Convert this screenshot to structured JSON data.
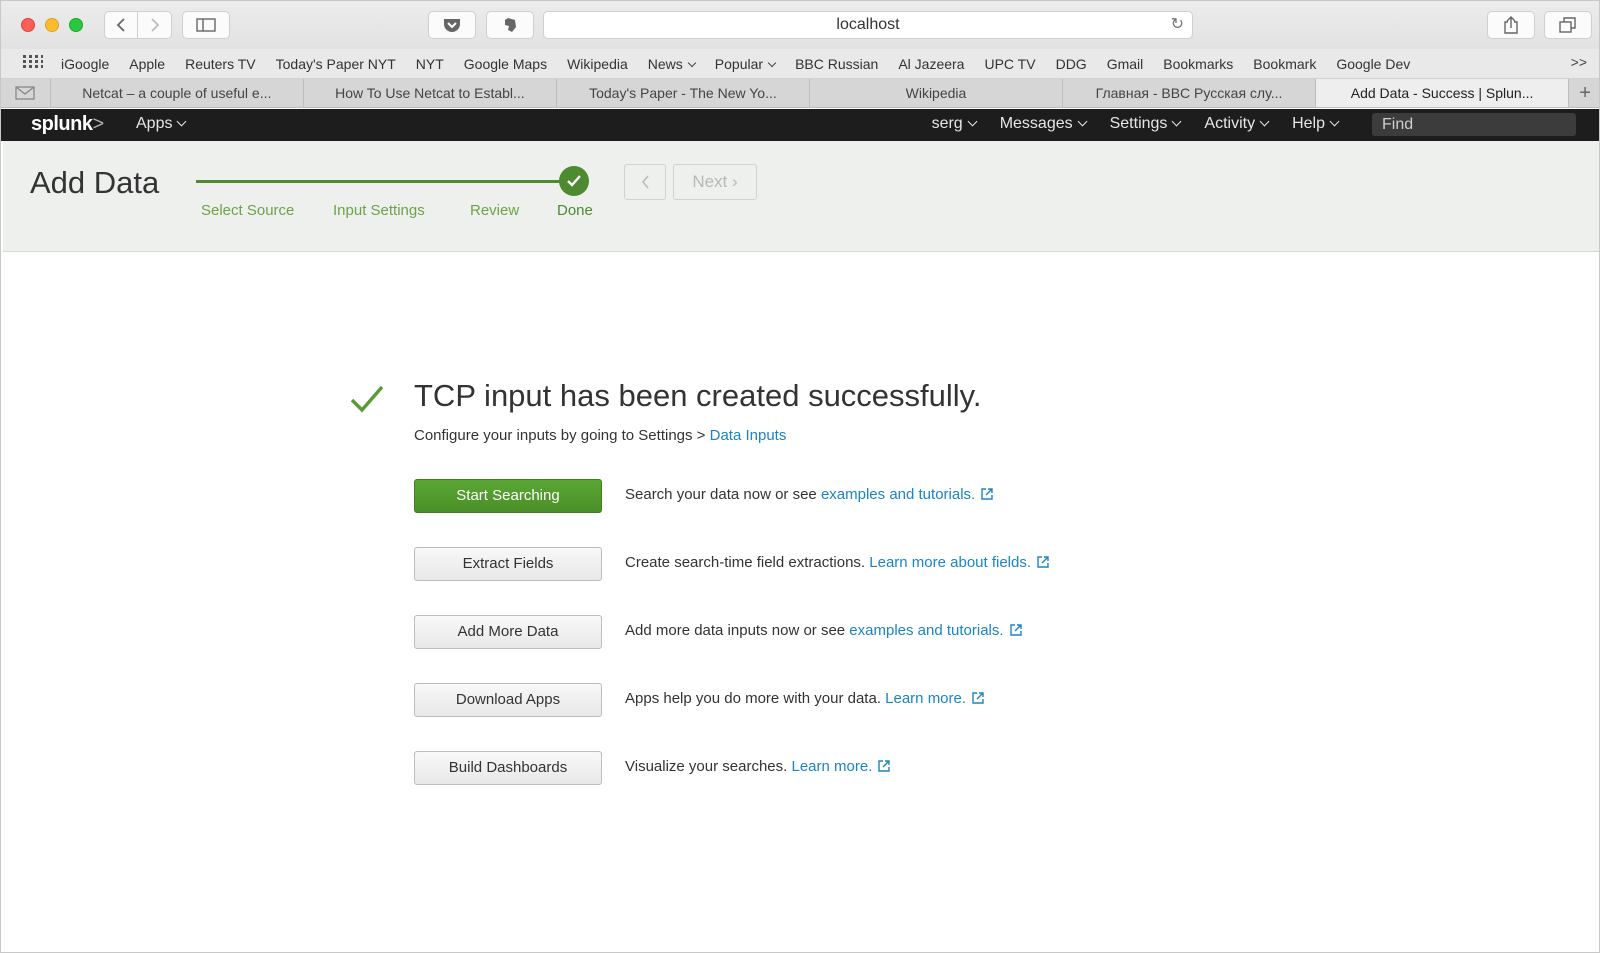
{
  "browser": {
    "url": "localhost",
    "bookmarks": [
      "iGoogle",
      "Apple",
      "Reuters TV",
      "Today's Paper NYT",
      "NYT",
      "Google Maps",
      "Wikipedia",
      "News",
      "Popular",
      "BBC Russian",
      "Al Jazeera",
      "UPC TV",
      "DDG",
      "Gmail",
      "Bookmarks",
      "Bookmark",
      "Google Dev"
    ],
    "bookmarks_dropdowns": [
      "News",
      "Popular"
    ],
    "more_label": ">>",
    "tabs": [
      {
        "label": "Netcat – a couple of useful e...",
        "active": false
      },
      {
        "label": "How To Use Netcat to Establ...",
        "active": false
      },
      {
        "label": "Today's Paper - The New Yo...",
        "active": false
      },
      {
        "label": "Wikipedia",
        "active": false
      },
      {
        "label": "Главная - BBC Русская слу...",
        "active": false
      },
      {
        "label": "Add Data - Success | Splun...",
        "active": true
      }
    ],
    "new_tab_label": "+"
  },
  "splunk": {
    "logo": "splunk",
    "logo_chevron": ">",
    "apps_label": "Apps",
    "user_label": "serg",
    "messages_label": "Messages",
    "settings_label": "Settings",
    "activity_label": "Activity",
    "help_label": "Help",
    "find_placeholder": "Find"
  },
  "wizard": {
    "title": "Add Data",
    "steps": [
      "Select Source",
      "Input Settings",
      "Review",
      "Done"
    ],
    "current_step": "Done",
    "next_label": "Next"
  },
  "success": {
    "title": "TCP input has been created successfully.",
    "subtitle_prefix": "Configure your inputs by going to Settings > ",
    "subtitle_link": "Data Inputs"
  },
  "actions": [
    {
      "button": "Start Searching",
      "primary": true,
      "desc": "Search your data now or see ",
      "link": "examples and tutorials."
    },
    {
      "button": "Extract Fields",
      "primary": false,
      "desc": "Create search-time field extractions. ",
      "link": "Learn more about fields."
    },
    {
      "button": "Add More Data",
      "primary": false,
      "desc": "Add more data inputs now or see ",
      "link": "examples and tutorials."
    },
    {
      "button": "Download Apps",
      "primary": false,
      "desc": "Apps help you do more with your data. ",
      "link": "Learn more."
    },
    {
      "button": "Build Dashboards",
      "primary": false,
      "desc": "Visualize your searches. ",
      "link": "Learn more."
    }
  ],
  "colors": {
    "splunk_green": "#4e8a30",
    "link_blue": "#1a85c4",
    "header_dark": "#1d1d1d"
  }
}
